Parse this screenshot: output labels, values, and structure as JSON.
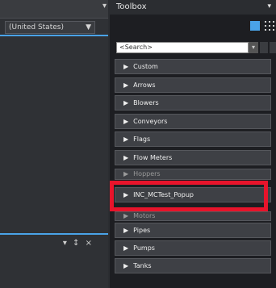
{
  "left_pane": {
    "dropdown_value": "(United States)",
    "panel_controls": "▾ ↕ ×"
  },
  "toolbox": {
    "title": "Toolbox",
    "search_placeholder": "<Search>",
    "categories": [
      {
        "label": "Custom"
      },
      {
        "label": "Arrows"
      },
      {
        "label": "Blowers"
      },
      {
        "label": "Conveyors"
      },
      {
        "label": "Flags"
      },
      {
        "label": "Flow Meters"
      },
      {
        "label": "Hoppers"
      },
      {
        "label": "INC_MCTest_Popup"
      },
      {
        "label": "Motors"
      },
      {
        "label": "Pipes"
      },
      {
        "label": "Pumps"
      },
      {
        "label": "Tanks"
      }
    ]
  },
  "colors": {
    "highlight": "#e8142b",
    "accent": "#4aa3e8"
  }
}
